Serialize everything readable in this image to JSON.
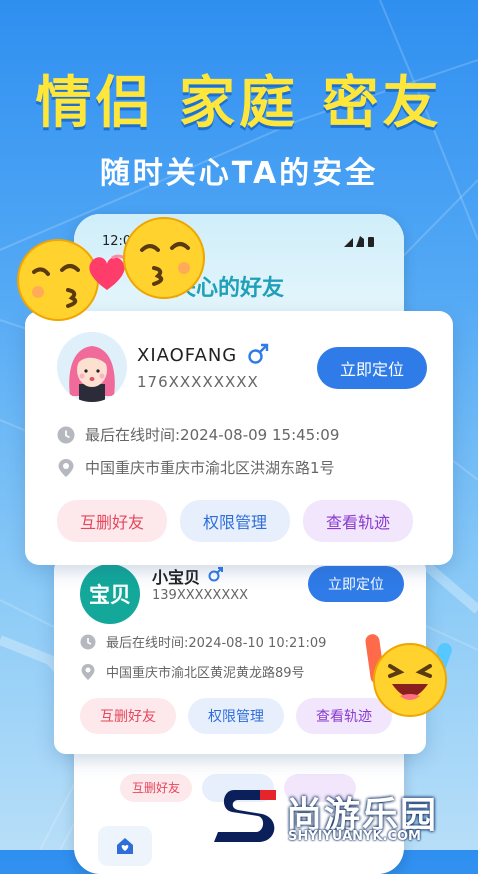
{
  "banner": {
    "headline": "情侣 家庭 密友",
    "subline": "随时关心TA的安全"
  },
  "phone": {
    "status_time": "12:0",
    "title": "关心的好友",
    "bottom_pill": "互删好友"
  },
  "friends": [
    {
      "name": "XIAOFANG",
      "gender_symbol": "♂",
      "phone": "176XXXXXXXX",
      "locate_label": "立即定位",
      "last_online": "最后在线时间:2024-08-09 15:45:09",
      "address": "中国重庆市重庆市渝北区洪湖东路1号",
      "actions": [
        "互删好友",
        "权限管理",
        "查看轨迹"
      ]
    },
    {
      "avatar_text": "宝贝",
      "name": "小宝贝",
      "gender_symbol": "♂",
      "phone": "139XXXXXXXX",
      "locate_label": "立即定位",
      "last_online": "最后在线时间:2024-08-10 10:21:09",
      "address": "中国重庆市渝北区黄泥黄龙路89号",
      "actions": [
        "互删好友",
        "权限管理",
        "查看轨迹"
      ]
    }
  ],
  "watermark": {
    "brand": "尚游乐园",
    "url": "SHYIYUANYK.COM"
  },
  "colors": {
    "accent_blue": "#2f7be8",
    "headline_yellow": "#ffe63b",
    "delete_red": "#e5475c",
    "track_purple": "#8a3bd0",
    "avatar_teal": "#13a89a"
  },
  "icons": [
    "clock-icon",
    "location-pin-icon",
    "male-symbol-icon",
    "kiss-emoji-icon",
    "laughing-emoji-icon",
    "heart-icon",
    "home-icon"
  ]
}
